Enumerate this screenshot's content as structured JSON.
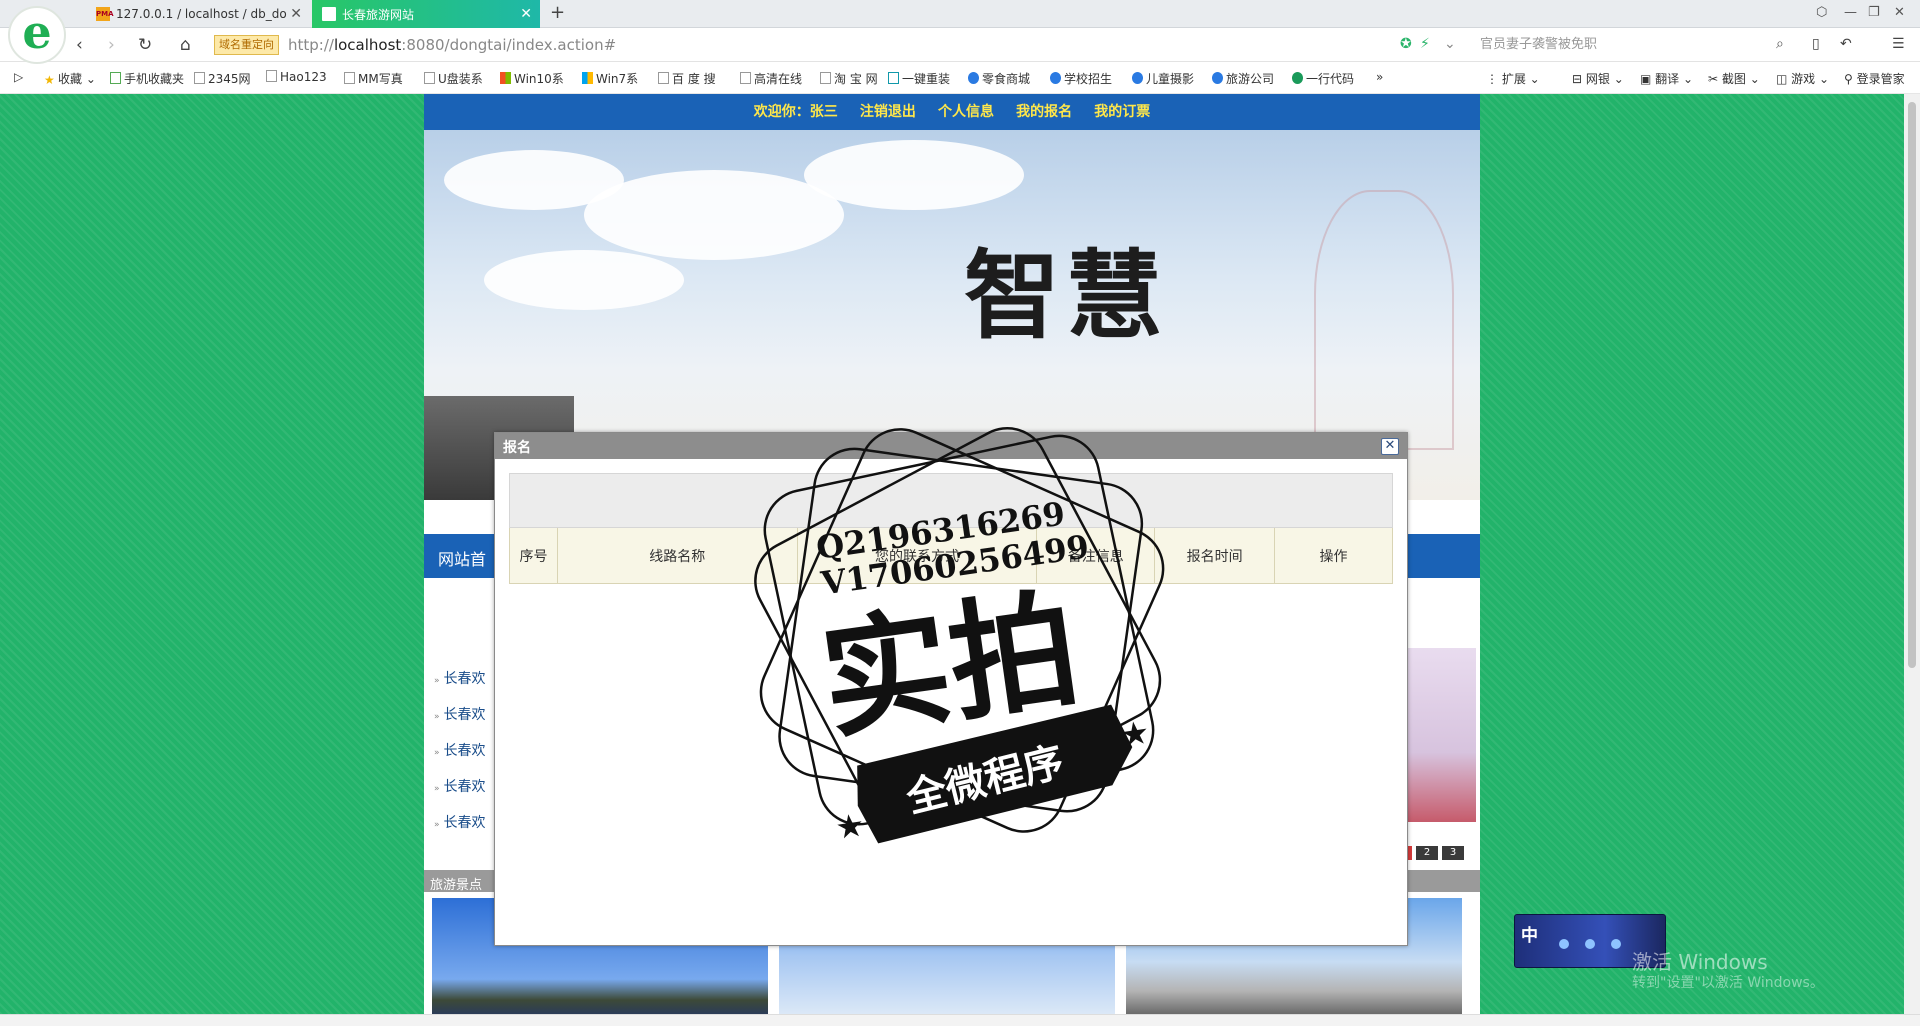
{
  "browser": {
    "tabs": [
      {
        "label": "127.0.0.1 / localhost / db_do"
      },
      {
        "label": "长春旅游网站"
      }
    ],
    "redirect_badge": "域名重定向",
    "url_scheme": "http://",
    "url_host": "localhost",
    "url_rest": ":8080/dongtai/index.action#",
    "search_placeholder": "官员妻子袭警被免职",
    "bookmarks": [
      "收藏",
      "手机收藏夹",
      "2345网",
      "Hao123",
      "MM写真",
      "U盘装系",
      "Win10系",
      "Win7系",
      "百 度 搜",
      "高清在线",
      "淘 宝 网",
      "一键重装",
      "零食商城",
      "学校招生",
      "儿童摄影",
      "旅游公司",
      "一行代码"
    ],
    "toolbar_right": [
      "扩展",
      "网银",
      "翻译",
      "截图",
      "游戏",
      "登录管家"
    ]
  },
  "site": {
    "topnav": [
      "欢迎你：张三",
      "注销退出",
      "个人信息",
      "我的报名",
      "我的订票"
    ],
    "banner_title": "智慧",
    "mainnav_first": "网站首",
    "news_items": [
      "长春欢",
      "长春欢",
      "长春欢",
      "长春欢",
      "长春欢"
    ],
    "pager": [
      "1",
      "2",
      "3"
    ],
    "scenic_header": "旅游景点"
  },
  "dialog": {
    "title": "报名",
    "columns": [
      "序号",
      "线路名称",
      "您的联系方式",
      "备注信息",
      "报名时间",
      "操作"
    ]
  },
  "stamp": {
    "line1": "Q2196316269",
    "line2": "V17060256499",
    "big": "实拍",
    "ribbon": "全微程序"
  },
  "ime": {
    "label": "中"
  },
  "activation": {
    "title": "激活 Windows",
    "sub": "转到\"设置\"以激活 Windows。"
  }
}
